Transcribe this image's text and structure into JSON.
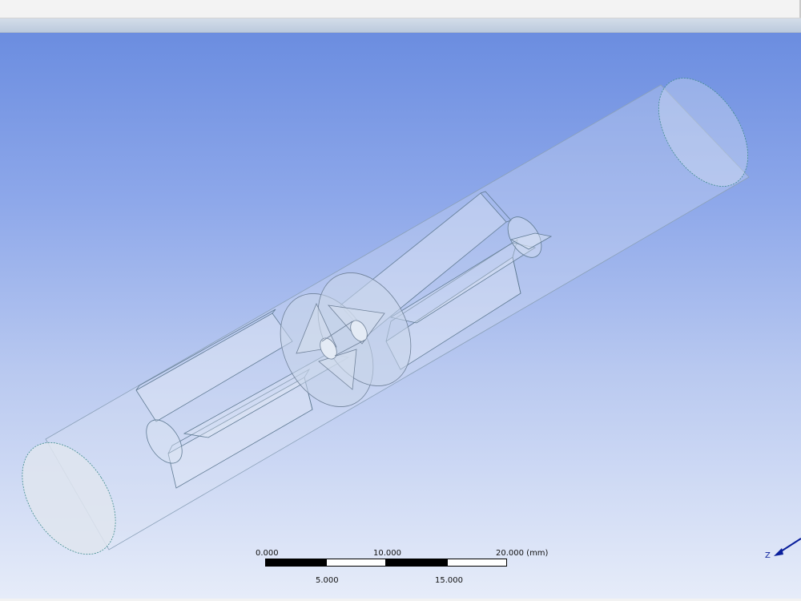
{
  "viewport": {
    "background_top": "#6b8de0",
    "background_bottom": "#e6ecf9",
    "edge_color": "#5f7a93",
    "body_fill": "#dde6f3"
  },
  "scale_bar": {
    "top_labels": [
      "0.000",
      "10.000",
      "20.000 (mm)"
    ],
    "bottom_labels": [
      "5.000",
      "15.000"
    ]
  },
  "triad": {
    "axis_label": "Z",
    "axis_color": "#0a1f9c",
    "icon": "axis-triad-icon"
  }
}
